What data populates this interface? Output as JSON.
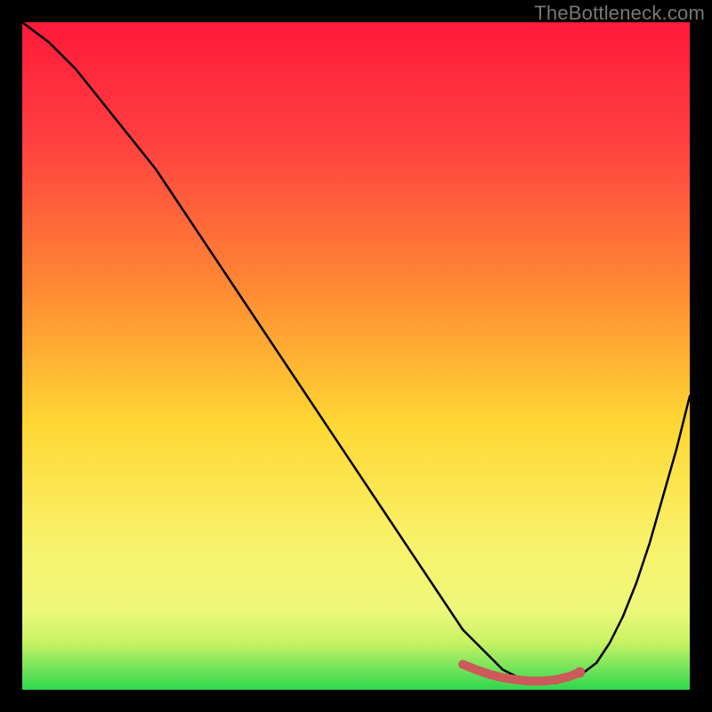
{
  "watermark": "TheBottleneck.com",
  "chart_data": {
    "type": "line",
    "title": "",
    "xlabel": "",
    "ylabel": "",
    "xlim": [
      0,
      100
    ],
    "ylim": [
      0,
      100
    ],
    "series": [
      {
        "name": "bottleneck-curve",
        "x": [
          0,
          4,
          8,
          12,
          16,
          20,
          24,
          28,
          32,
          36,
          40,
          44,
          48,
          52,
          56,
          60,
          64,
          66,
          68,
          70,
          72,
          74,
          76,
          78,
          80,
          82,
          84,
          86,
          88,
          90,
          92,
          94,
          96,
          98,
          100
        ],
        "y": [
          100,
          97,
          93,
          88,
          83,
          78,
          72,
          66,
          60,
          54,
          48,
          42,
          36,
          30,
          24,
          18,
          12,
          9,
          7,
          5,
          3,
          2,
          1.2,
          1,
          1,
          1.5,
          2.5,
          4,
          7,
          11,
          16,
          22,
          29,
          36,
          44
        ]
      },
      {
        "name": "sweet-spot",
        "x": [
          66,
          68,
          70,
          72,
          74,
          76,
          78,
          80,
          82,
          83.5
        ],
        "y": [
          3.8,
          3.0,
          2.3,
          1.8,
          1.5,
          1.3,
          1.3,
          1.5,
          2.0,
          2.6
        ]
      }
    ],
    "gradient_stops": [
      {
        "offset": 0,
        "color": "#ff1a3a"
      },
      {
        "offset": 18,
        "color": "#ff4040"
      },
      {
        "offset": 40,
        "color": "#ff8a33"
      },
      {
        "offset": 60,
        "color": "#ffd733"
      },
      {
        "offset": 78,
        "color": "#f8f26a"
      },
      {
        "offset": 88,
        "color": "#eef77a"
      },
      {
        "offset": 93,
        "color": "#c7f264"
      },
      {
        "offset": 97,
        "color": "#6fe35a"
      },
      {
        "offset": 100,
        "color": "#2fd84e"
      }
    ],
    "colors": {
      "curve": "#000000",
      "sweet_spot": "#cc5a5a",
      "sweet_spot_dot": "#cc5a5a"
    }
  }
}
